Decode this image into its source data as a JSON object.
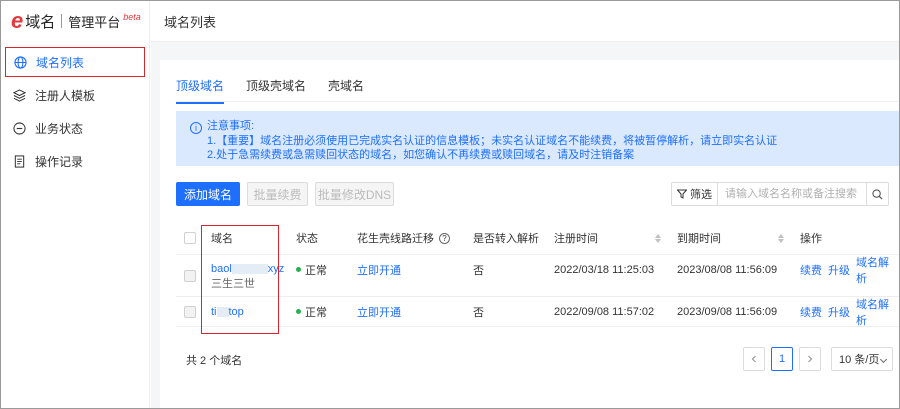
{
  "brand": {
    "logo_letter": "e",
    "name": "域名",
    "sub": "管理平台",
    "badge": "beta"
  },
  "sidebar": {
    "items": [
      {
        "label": "域名列表",
        "icon": "globe-icon",
        "active": true
      },
      {
        "label": "注册人模板",
        "icon": "layers-icon",
        "active": false
      },
      {
        "label": "业务状态",
        "icon": "status-icon",
        "active": false
      },
      {
        "label": "操作记录",
        "icon": "document-icon",
        "active": false
      }
    ]
  },
  "header": {
    "title": "域名列表"
  },
  "tabs": [
    {
      "label": "顶级域名",
      "active": true
    },
    {
      "label": "顶级壳域名",
      "active": false
    },
    {
      "label": "壳域名",
      "active": false
    }
  ],
  "notice": {
    "title": "注意事项:",
    "line1": "1.【重要】域名注册必须使用已完成实名认证的信息模板；未实名认证域名不能续费，将被暂停解析，请立即实名认证",
    "line2": "2.处于急需续费或急需赎回状态的域名，如您确认不再续费或赎回域名，请及时注销备案"
  },
  "toolbar": {
    "add_label": "添加域名",
    "batch_renew_label": "批量续费",
    "batch_dns_label": "批量修改DNS",
    "filter_label": "筛选",
    "search_placeholder": "请输入域名名称或备注搜索"
  },
  "table": {
    "columns": [
      "域名",
      "状态",
      "花生壳线路迁移",
      "是否转入解析",
      "注册时间",
      "到期时间",
      "操作"
    ],
    "rows": [
      {
        "domain_prefix": "baol",
        "domain_suffix": "xyz",
        "note": "三生三世",
        "status": "正常",
        "migrate": "立即开通",
        "transferred": "否",
        "registered": "2022/03/18 11:25:03",
        "expires": "2023/08/08 11:56:09",
        "actions": [
          "续费",
          "升级",
          "域名解析"
        ]
      },
      {
        "domain_prefix": "ti",
        "domain_suffix": "top",
        "note": "",
        "status": "正常",
        "migrate": "立即开通",
        "transferred": "否",
        "registered": "2022/09/08 11:57:02",
        "expires": "2023/09/08 11:56:09",
        "actions": [
          "续费",
          "升级",
          "域名解析"
        ]
      }
    ]
  },
  "pagination": {
    "total_text": "共 2 个域名",
    "current_page": "1",
    "page_size": "10 条/页"
  },
  "colors": {
    "primary": "#1e6fff",
    "brand_red": "#e4393c",
    "highlight_border": "#d9262c",
    "status_green": "#26b24c",
    "notice_bg": "#dbe9ff"
  }
}
